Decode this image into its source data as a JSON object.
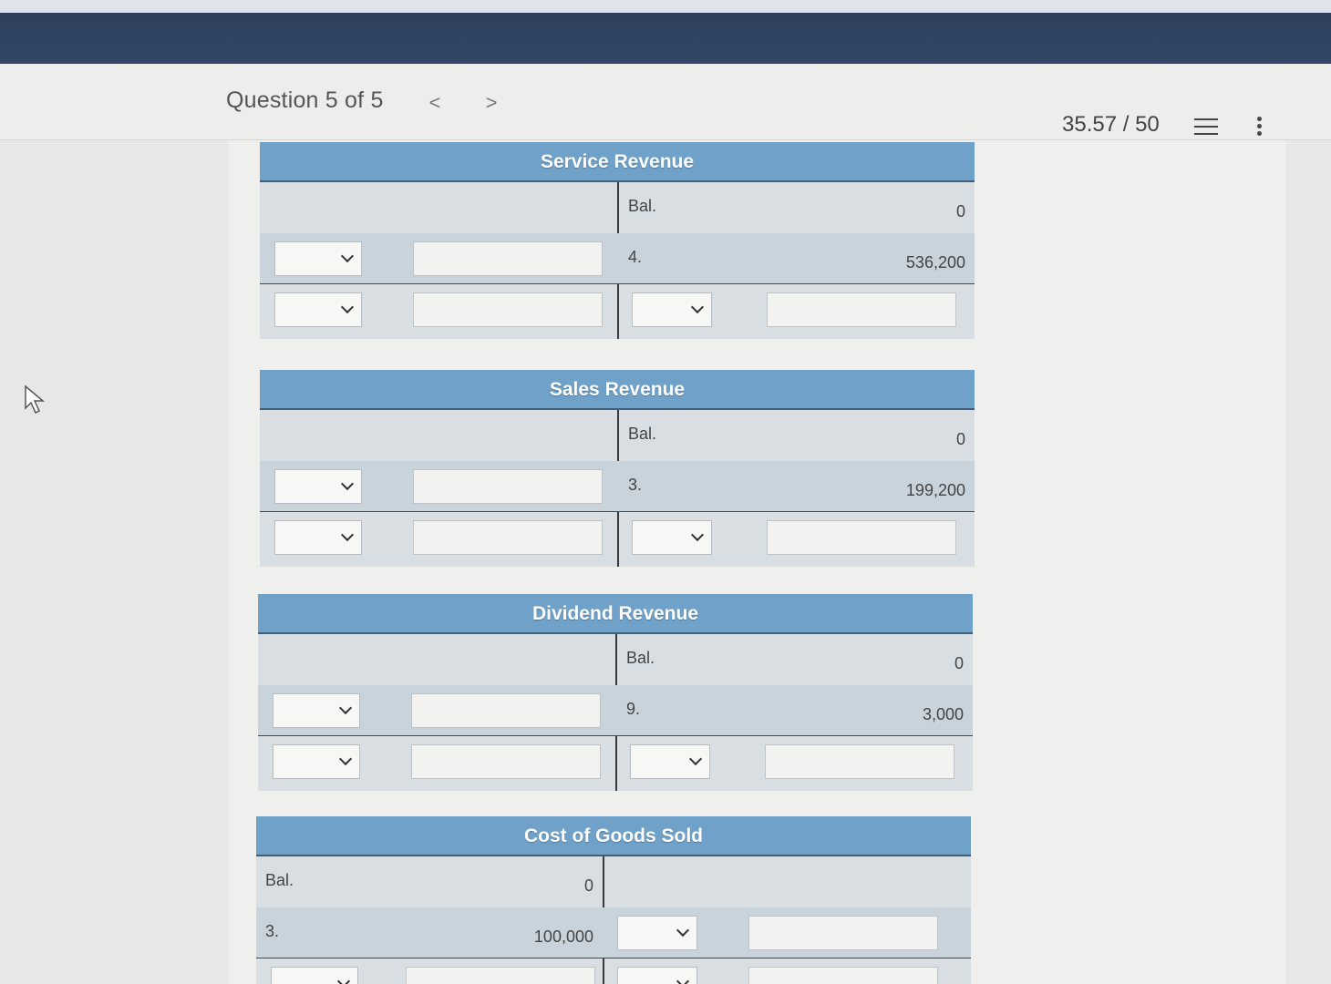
{
  "header": {
    "question_label": "Question 5 of 5",
    "prev_glyph": "<",
    "next_glyph": ">",
    "score": "35.57 / 50",
    "list_icon": "list-icon",
    "more_icon": "more-vertical-icon"
  },
  "accounts": [
    {
      "title": "Service Revenue",
      "credit_side": {
        "rows": [
          {
            "label": "Bal.",
            "amount": "0"
          },
          {
            "label": "4.",
            "amount": "536,200"
          }
        ]
      }
    },
    {
      "title": "Sales Revenue",
      "credit_side": {
        "rows": [
          {
            "label": "Bal.",
            "amount": "0"
          },
          {
            "label": "3.",
            "amount": "199,200"
          }
        ]
      }
    },
    {
      "title": "Dividend Revenue",
      "credit_side": {
        "rows": [
          {
            "label": "Bal.",
            "amount": "0"
          },
          {
            "label": "9.",
            "amount": "3,000"
          }
        ]
      }
    },
    {
      "title": "Cost of Goods Sold",
      "debit_side": {
        "rows": [
          {
            "label": "Bal.",
            "amount": "0"
          },
          {
            "label": "3.",
            "amount": "100,000"
          }
        ]
      }
    }
  ]
}
